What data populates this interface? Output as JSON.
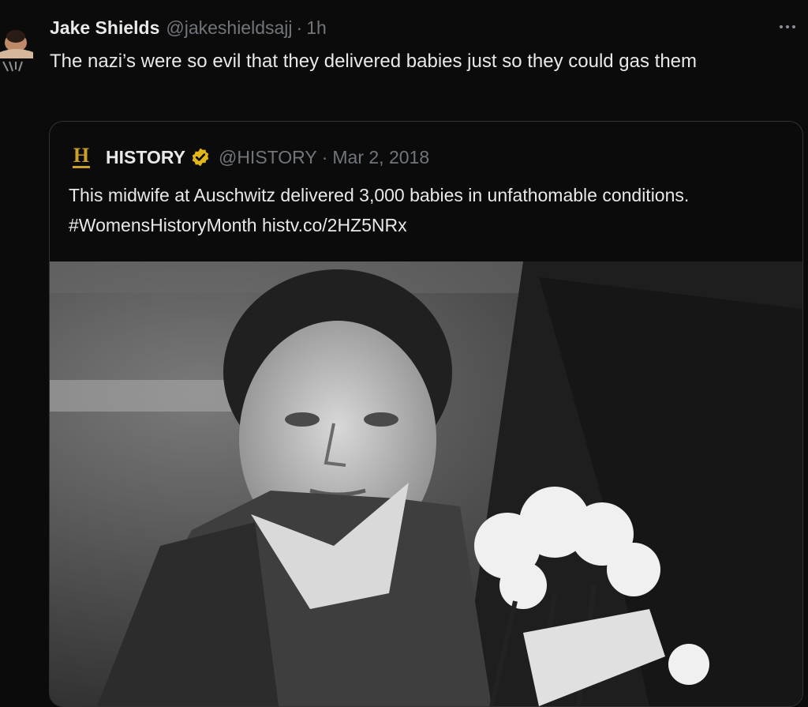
{
  "tweet": {
    "author_name": "Jake Shields",
    "author_handle": "@jakeshieldsajj",
    "separator": "·",
    "time": "1h",
    "text": "The nazi’s were so evil that they delivered babies just so they could gas them",
    "avatar_icon": "user-avatar",
    "more_icon": "more-horizontal-icon"
  },
  "quoted_tweet": {
    "logo_letter": "H",
    "author_name": "HISTORY",
    "verified_icon": "verified-gold-badge-icon",
    "author_handle": "@HISTORY",
    "separator": "·",
    "date": "Mar 2, 2018",
    "text": "This midwife at Auschwitz delivered 3,000 babies in unfathomable conditions. #WomensHistoryMonth histv.co/2HZ5NRx",
    "media_description": "black-and-white photo"
  },
  "colors": {
    "background": "#0b0b0c",
    "text_primary": "#e7e9ea",
    "text_secondary": "#71767b",
    "border": "#2f3336",
    "gold": "#c9a227"
  }
}
